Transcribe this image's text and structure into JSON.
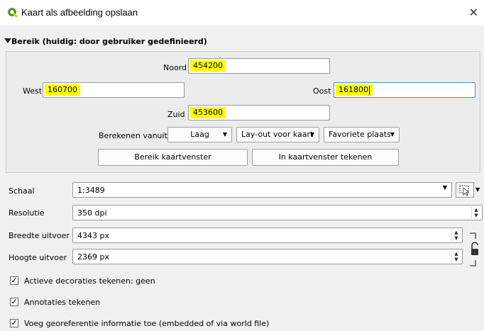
{
  "window": {
    "title": "Kaart als afbeelding opslaan"
  },
  "extent": {
    "header": "Bereik (huidig: door gebruiker gedefinieerd)",
    "north_label": "Noord",
    "north_value": "454200",
    "west_label": "West",
    "west_value": "160700",
    "east_label": "Oost",
    "east_value": "161800",
    "south_label": "Zuid",
    "south_value": "453600",
    "calc_from_label": "Berekenen vanuit",
    "layer_combo": "Laag",
    "layout_combo": "Lay-out voor kaart",
    "bookmarks_combo": "Favoriete plaats",
    "map_extent_button": "Bereik kaartvenster",
    "draw_on_canvas_button": "In kaartvenster tekenen"
  },
  "settings": {
    "scale_label": "Schaal",
    "scale_value": "1:3489",
    "resolution_label": "Resolutie",
    "resolution_value": "350 dpi",
    "width_label": "Breedte uitvoer",
    "width_value": "4343 px",
    "height_label": "Hoogte uitvoer",
    "height_value": "2369 px"
  },
  "checks": [
    {
      "label": "Actieve decoraties tekenen: geen",
      "checked": true
    },
    {
      "label": "Annotaties tekenen",
      "checked": true
    },
    {
      "label": "Voeg georeferentie informatie toe (embedded of via world file)",
      "checked": true
    }
  ],
  "colors": {
    "highlight": "#ffff00",
    "qgis_green": "#589632",
    "focus_border": "#4a90d9"
  }
}
